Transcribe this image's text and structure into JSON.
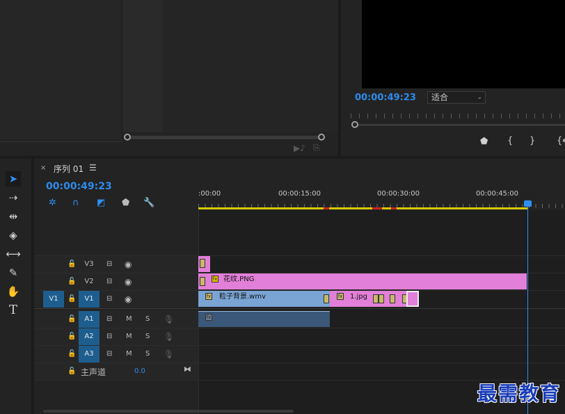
{
  "program_monitor": {
    "timecode": "00:00:49:23",
    "fit_select": "适合"
  },
  "sequence": {
    "tab_label": "序列 01",
    "timecode": "00:00:49:23",
    "ruler_labels": [
      ":00:00",
      "00:00:15:00",
      "00:00:30:00",
      "00:00:45:00"
    ]
  },
  "tracks": {
    "v3": "V3",
    "v2": "V2",
    "v1": "V1",
    "v1_source": "V1",
    "a1": "A1",
    "a2": "A2",
    "a3": "A3",
    "mix_label": "主声道",
    "mix_value": "0.0",
    "mute_label": "M",
    "solo_label": "S"
  },
  "clips": {
    "v2_main": "花纹.PNG",
    "v1_particle": "粒子背景.wmv",
    "v1_jpg": "1.jpg",
    "fx_label": "fx"
  },
  "icons": {
    "close": "×",
    "menu": "☰"
  },
  "watermark": "最需教育",
  "colors": {
    "accent_blue": "#2d8ceb",
    "clip_pink": "#e27fd8",
    "clip_blue": "#7aa4d4",
    "work_area": "#d6c900"
  }
}
